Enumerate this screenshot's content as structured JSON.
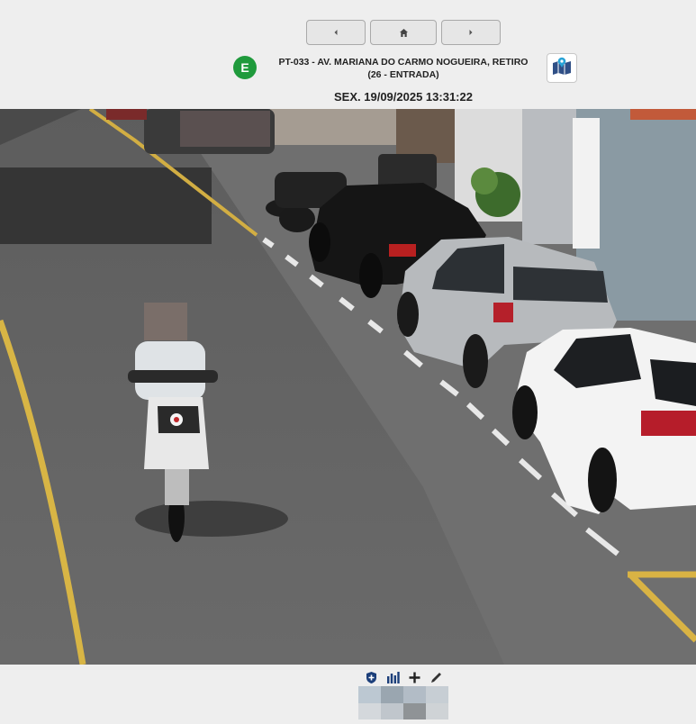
{
  "nav": {
    "prev_icon": "chevron-left-icon",
    "home_icon": "home-icon",
    "next_icon": "chevron-right-icon"
  },
  "camera_info": {
    "direction_badge": "E",
    "badge_color": "#1f9a3c",
    "location_line1": "PT-033 - AV. MARIANA DO CARMO NOGUEIRA, RETIRO",
    "location_line2": "(26 - ENTRADA)",
    "map_icon": "map-icon",
    "datetime": "SEX. 19/09/2025 13:31:22"
  },
  "toolbar": {
    "icons": [
      "shield-plus-icon",
      "bar-chart-icon",
      "plus-icon",
      "pencil-icon"
    ]
  },
  "plate_crop": {
    "pixelated": true
  }
}
